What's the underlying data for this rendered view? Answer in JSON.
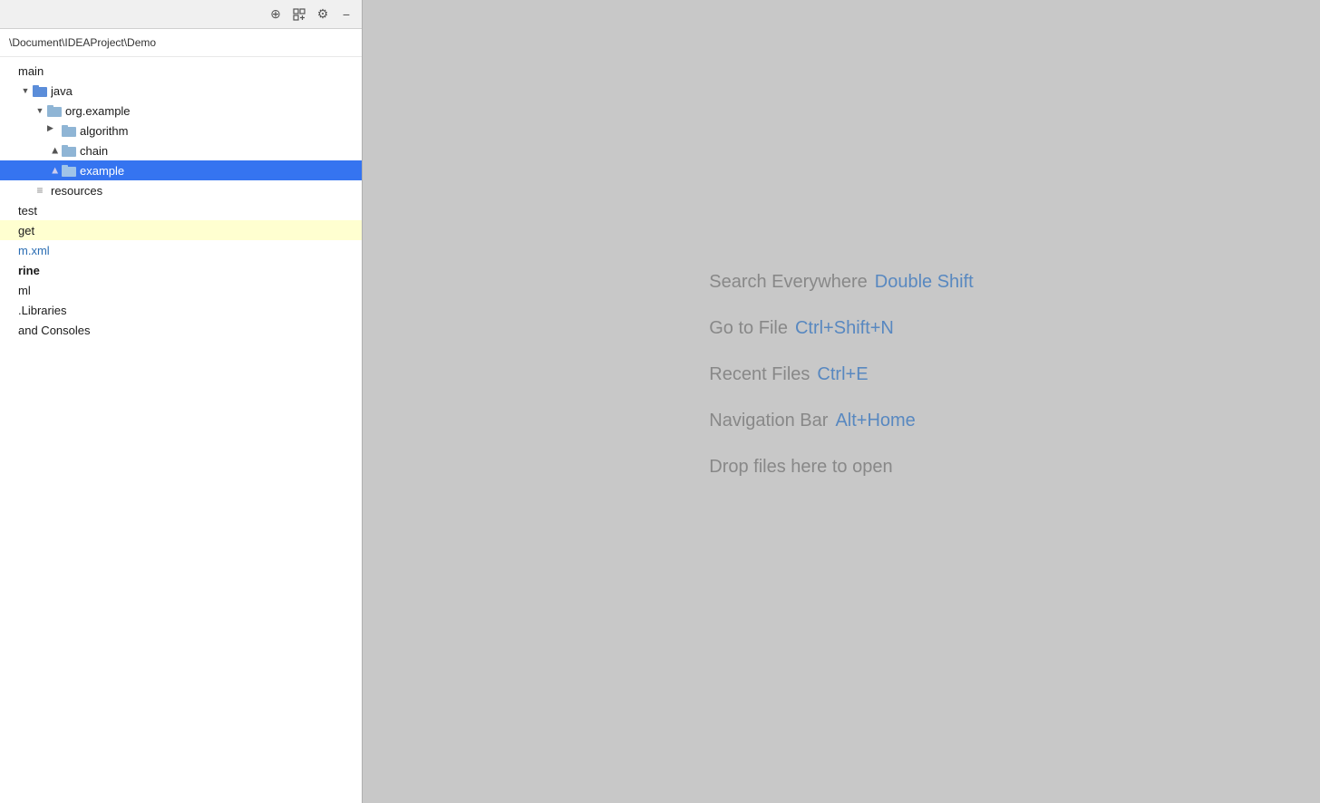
{
  "toolbar": {
    "icons": [
      {
        "name": "add-content-icon",
        "symbol": "⊕"
      },
      {
        "name": "collapse-all-icon",
        "symbol": "⇊"
      },
      {
        "name": "settings-icon",
        "symbol": "⚙"
      },
      {
        "name": "minimize-icon",
        "symbol": "−"
      }
    ]
  },
  "project_path": "\\Document\\IDEAProject\\Demo",
  "tree": {
    "items": [
      {
        "id": "main",
        "label": "main",
        "indent": 0,
        "type": "plain",
        "arrow": "none"
      },
      {
        "id": "java",
        "label": "java",
        "indent": 1,
        "type": "java-src",
        "arrow": "expanded"
      },
      {
        "id": "org.example",
        "label": "org.example",
        "indent": 2,
        "type": "package",
        "arrow": "expanded"
      },
      {
        "id": "algorithm",
        "label": "algorithm",
        "indent": 3,
        "type": "package",
        "arrow": "collapsed"
      },
      {
        "id": "chain",
        "label": "chain",
        "indent": 3,
        "type": "package",
        "arrow": "collapsed"
      },
      {
        "id": "example",
        "label": "example",
        "indent": 3,
        "type": "package",
        "arrow": "collapsed",
        "selected": true
      },
      {
        "id": "resources",
        "label": "resources",
        "indent": 1,
        "type": "resources",
        "arrow": "none"
      },
      {
        "id": "test",
        "label": "test",
        "indent": 0,
        "type": "plain",
        "arrow": "none"
      },
      {
        "id": "get",
        "label": "get",
        "indent": 0,
        "type": "plain",
        "arrow": "none",
        "highlighted": true
      },
      {
        "id": "m.xml",
        "label": "m.xml",
        "indent": 0,
        "type": "xml",
        "arrow": "none"
      },
      {
        "id": "rine",
        "label": "rine",
        "indent": 0,
        "type": "plain-bold",
        "arrow": "none"
      },
      {
        "id": "ml",
        "label": "ml",
        "indent": 0,
        "type": "plain",
        "arrow": "none"
      },
      {
        "id": "libraries",
        "label": ".Libraries",
        "indent": 0,
        "type": "plain",
        "arrow": "none"
      },
      {
        "id": "consoles",
        "label": "and Consoles",
        "indent": 0,
        "type": "plain",
        "arrow": "none"
      }
    ]
  },
  "hints": [
    {
      "label": "Search Everywhere",
      "shortcut": "Double Shift"
    },
    {
      "label": "Go to File",
      "shortcut": "Ctrl+Shift+N"
    },
    {
      "label": "Recent Files",
      "shortcut": "Ctrl+E"
    },
    {
      "label": "Navigation Bar",
      "shortcut": "Alt+Home"
    },
    {
      "label": "Drop files here to open",
      "shortcut": ""
    }
  ]
}
